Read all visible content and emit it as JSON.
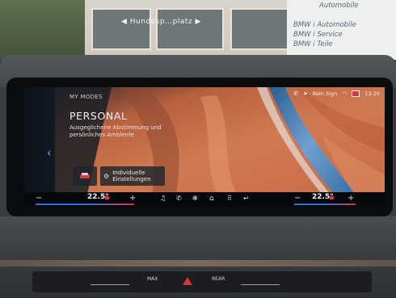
{
  "exterior": {
    "direction_sign": "◀ Hundesp…platz ▶",
    "dealer_lines": [
      "Automobile",
      "BMW  i Automobile",
      "BMW  i Service",
      "BMW  i Teile"
    ]
  },
  "screen": {
    "section_label": "MY MODES",
    "mode_title": "PERSONAL",
    "mode_description": "Ausgeglichene Abstimmung und persönliches Ambiente",
    "status": {
      "nav_sign_text": "Kein Sign",
      "time": "13:20",
      "icons": [
        "phone-icon",
        "navigation-arrow-icon",
        "wifi-icon",
        "flag-icon"
      ]
    },
    "tiles": {
      "tile_a_icon": "vehicle-icon",
      "tile_b_icon": "settings-gear-icon",
      "tile_b_label": "Individuelle Einstellungen"
    },
    "climate": {
      "left_temp": "22.5°",
      "right_temp": "22.5°",
      "minus": "−",
      "plus": "+"
    },
    "nav_icons": [
      "music-icon",
      "phone-icon",
      "fan-icon",
      "home-icon",
      "apps-grid-icon",
      "return-icon"
    ]
  },
  "hvac_panel": {
    "max_label": "MAX",
    "rear_label": "REAR"
  },
  "colors": {
    "accent_blue": "#2f6fe0",
    "accent_red": "#e0353b",
    "terrain_orange": "#c46a45",
    "water_blue": "#4f82b5"
  }
}
